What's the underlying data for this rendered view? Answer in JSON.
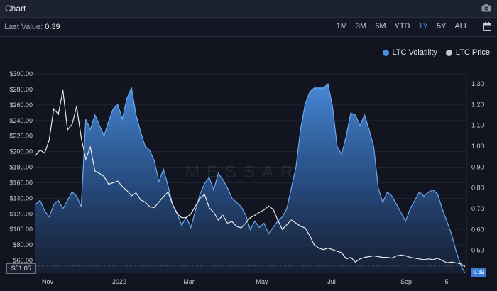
{
  "header": {
    "title": "Chart",
    "camera_icon": "camera-icon"
  },
  "toolbar": {
    "last_value_label": "Last Value:",
    "last_value": "0.39",
    "ranges": [
      "1M",
      "3M",
      "6M",
      "YTD",
      "1Y",
      "5Y",
      "ALL"
    ],
    "active_range": "1Y",
    "calendar_icon": "calendar-icon"
  },
  "watermark": "MESSARI",
  "colors": {
    "volatility": "#4a90e2",
    "price": "#e8e8ec",
    "background": "#12151f"
  },
  "chart_data": {
    "type": "area",
    "x_tick_labels": [
      "Nov",
      "2022",
      "Mar",
      "May",
      "Jul",
      "Sep",
      "5"
    ],
    "left_axis": {
      "ticks": [
        "$300.00",
        "$280.00",
        "$260.00",
        "$240.00",
        "$220.00",
        "$200.00",
        "$180.00",
        "$160.00",
        "$140.00",
        "$120.00",
        "$100.00",
        "$80.00",
        "$60.00"
      ],
      "range": [
        51.05,
        300
      ],
      "current_label": "$51.05"
    },
    "right_axis": {
      "ticks": [
        "1.30",
        "1.20",
        "1.10",
        "1.00",
        "0.90",
        "0.80",
        "0.70",
        "0.60",
        "0.50",
        "0.40"
      ],
      "range": [
        0.36,
        1.33
      ],
      "current_label": "0.39"
    },
    "series": [
      {
        "name": "LTC Volatility",
        "axis": "right",
        "style": "area",
        "values": [
          0.72,
          0.74,
          0.69,
          0.66,
          0.72,
          0.74,
          0.7,
          0.74,
          0.78,
          0.76,
          0.71,
          1.13,
          1.08,
          1.15,
          1.1,
          1.05,
          1.12,
          1.18,
          1.2,
          1.13,
          1.23,
          1.28,
          1.15,
          1.07,
          1.0,
          0.98,
          0.93,
          0.83,
          0.89,
          0.81,
          0.72,
          0.68,
          0.62,
          0.66,
          0.61,
          0.69,
          0.77,
          0.82,
          0.85,
          0.79,
          0.87,
          0.84,
          0.8,
          0.75,
          0.73,
          0.71,
          0.67,
          0.6,
          0.64,
          0.61,
          0.63,
          0.58,
          0.61,
          0.64,
          0.66,
          0.7,
          0.8,
          0.9,
          1.08,
          1.2,
          1.26,
          1.28,
          1.28,
          1.28,
          1.3,
          1.19,
          1.0,
          0.96,
          1.05,
          1.16,
          1.15,
          1.1,
          1.15,
          1.08,
          1.0,
          0.8,
          0.73,
          0.78,
          0.76,
          0.72,
          0.68,
          0.64,
          0.7,
          0.74,
          0.78,
          0.76,
          0.78,
          0.79,
          0.77,
          0.7,
          0.64,
          0.58,
          0.5,
          0.43,
          0.39
        ]
      },
      {
        "name": "LTC Price",
        "axis": "left",
        "style": "line",
        "values": [
          195,
          202,
          198,
          215,
          255,
          248,
          279,
          228,
          235,
          258,
          218,
          190,
          206,
          175,
          172,
          168,
          158,
          160,
          162,
          155,
          150,
          143,
          147,
          138,
          135,
          129,
          128,
          135,
          142,
          148,
          132,
          120,
          115,
          115,
          120,
          130,
          140,
          145,
          128,
          122,
          112,
          118,
          108,
          110,
          104,
          102,
          108,
          115,
          118,
          122,
          125,
          130,
          126,
          112,
          100,
          106,
          112,
          108,
          104,
          102,
          92,
          80,
          76,
          74,
          76,
          74,
          72,
          70,
          62,
          64,
          58,
          62,
          64,
          65,
          66,
          65,
          64,
          64,
          63,
          66,
          67,
          66,
          64,
          63,
          62,
          61,
          62,
          61,
          63,
          60,
          57,
          58,
          57,
          56,
          52
        ]
      }
    ]
  }
}
